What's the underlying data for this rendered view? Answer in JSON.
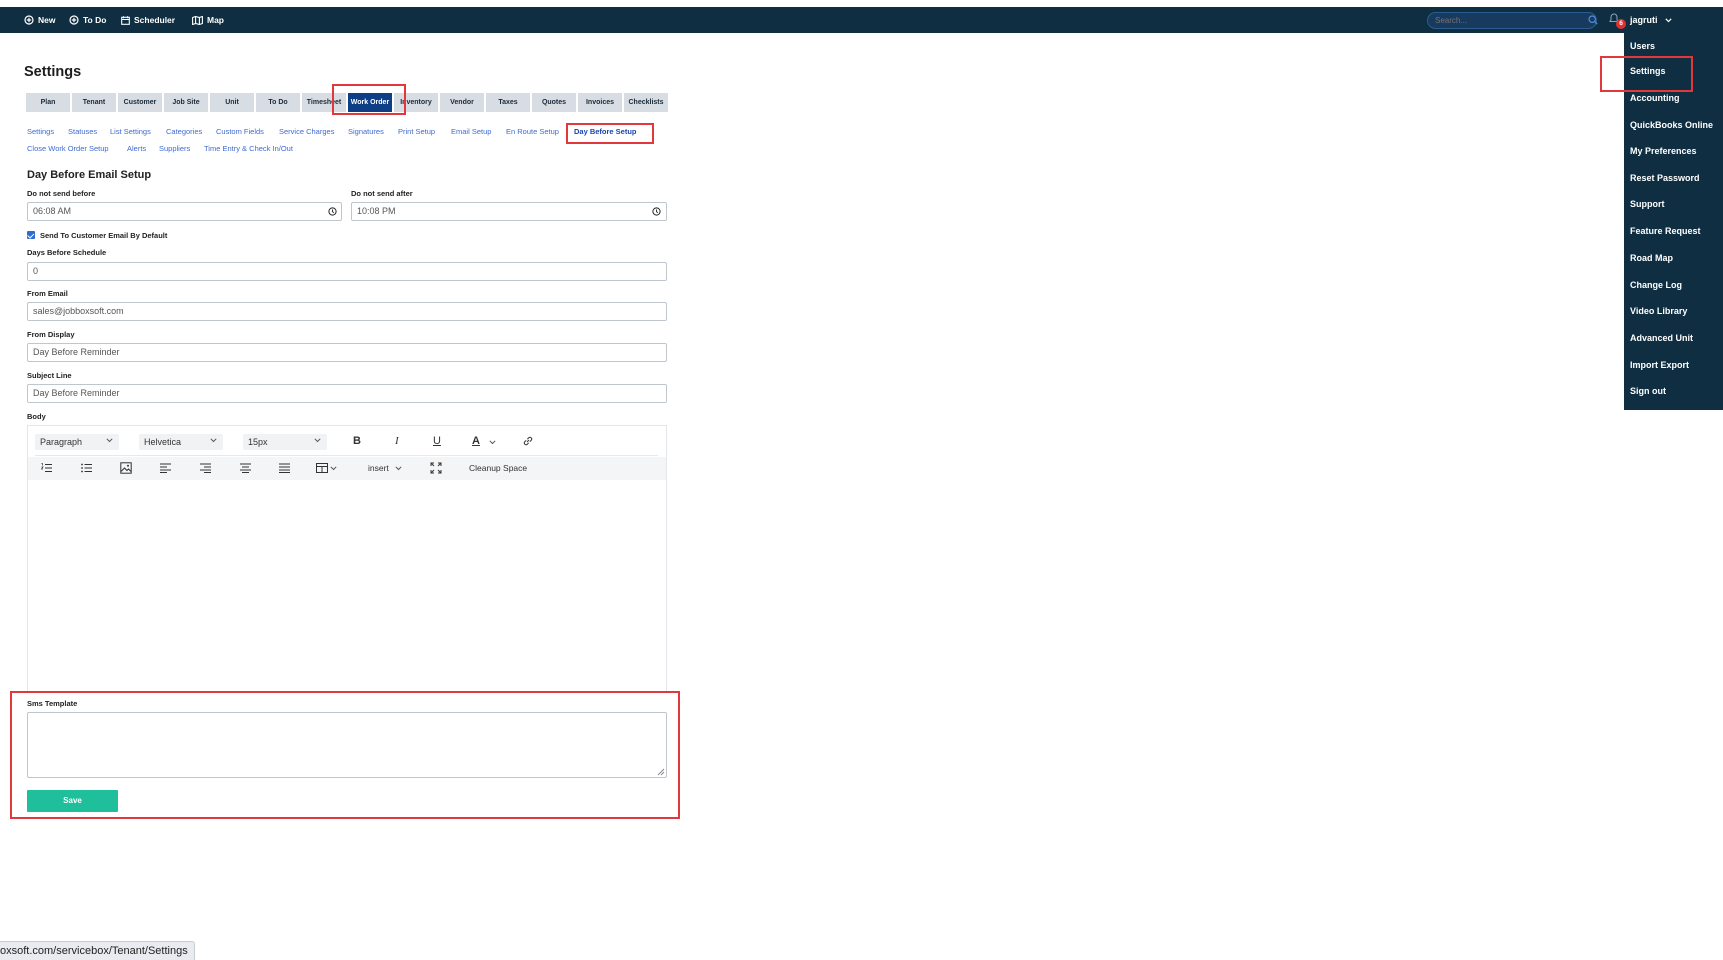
{
  "nav": {
    "new": "New",
    "todo": "To Do",
    "scheduler": "Scheduler",
    "map": "Map",
    "search_placeholder": "Search...",
    "notification_count": "6",
    "username": "jagruti"
  },
  "user_menu": {
    "items": [
      "Users",
      "Settings",
      "Accounting",
      "QuickBooks Online",
      "My Preferences",
      "Reset Password",
      "Support",
      "Feature Request",
      "Road Map",
      "Change Log",
      "Video Library",
      "Advanced Unit",
      "Import Export",
      "Sign out"
    ]
  },
  "page": {
    "title": "Settings"
  },
  "tabs": [
    "Plan",
    "Tenant",
    "Customer",
    "Job Site",
    "Unit",
    "To Do",
    "Timesheet",
    "Work Order",
    "Inventory",
    "Vendor",
    "Taxes",
    "Quotes",
    "Invoices",
    "Checklists"
  ],
  "active_tab": "Work Order",
  "sublinks_row1": [
    "Settings",
    "Statuses",
    "List Settings",
    "Categories",
    "Custom Fields",
    "Service Charges",
    "Signatures",
    "Print Setup",
    "Email Setup",
    "En Route Setup",
    "Day Before Setup"
  ],
  "sublinks_row2": [
    "Close Work Order Setup",
    "Alerts",
    "Suppliers",
    "Time Entry & Check In/Out"
  ],
  "form": {
    "section_title": "Day Before Email Setup",
    "not_before_label": "Do not send before",
    "not_before_value": "06:08 AM",
    "not_after_label": "Do not send after",
    "not_after_value": "10:08 PM",
    "send_default_label": "Send To Customer Email By Default",
    "send_default_checked": true,
    "days_label": "Days Before Schedule",
    "days_value": "0",
    "from_email_label": "From Email",
    "from_email_value": "sales@jobboxsoft.com",
    "from_display_label": "From Display",
    "from_display_value": "Day Before Reminder",
    "subject_label": "Subject Line",
    "subject_value": "Day Before Reminder",
    "body_label": "Body",
    "sms_label": "Sms Template",
    "sms_value": "",
    "save_label": "Save"
  },
  "editor": {
    "block_format": "Paragraph",
    "font_family": "Helvetica",
    "font_size": "15px",
    "bold": "B",
    "italic": "I",
    "underline": "U",
    "text_color": "A",
    "insert": "insert",
    "cleanup": "Cleanup Space"
  },
  "status_url": "oxsoft.com/servicebox/Tenant/Settings",
  "colors": {
    "navbar": "#0f2e41",
    "active_tab": "#0e3f86",
    "save_button": "#1fbf9b",
    "highlight": "#e3383b",
    "link": "#3f6bd1"
  }
}
